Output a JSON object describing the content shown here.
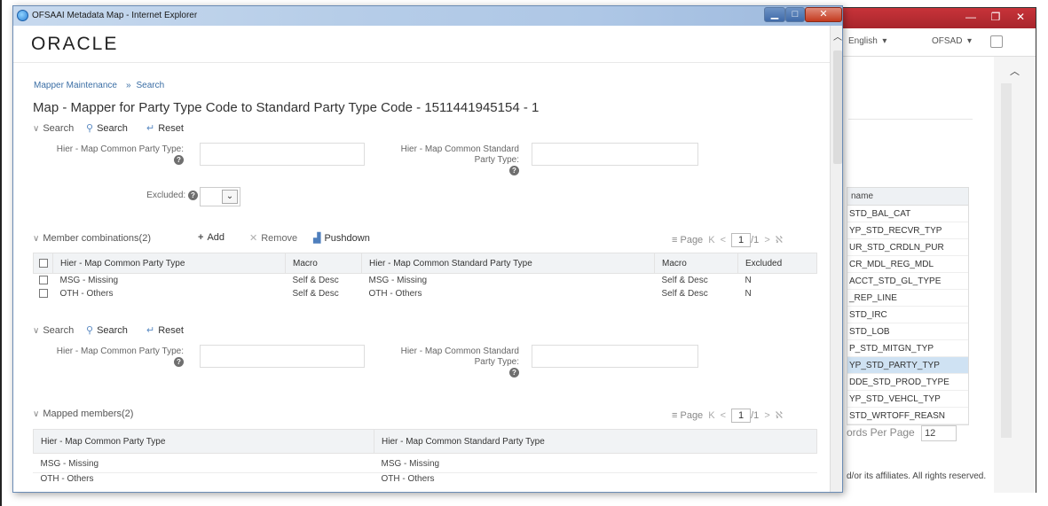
{
  "window": {
    "title": "OFSAAI Metadata Map - Internet Explorer",
    "logo": "ORACLE"
  },
  "breadcrumb": [
    "Mapper Maintenance",
    "Search"
  ],
  "page_title": "Map - Mapper for Party Type Code to Standard Party Type Code - 1511441945154 - 1",
  "search1": {
    "header": "Search",
    "search_label": "Search",
    "reset_label": "Reset",
    "field1_label": "Hier - Map Common Party Type:",
    "field2_label_line1": "Hier - Map Common Standard",
    "field2_label_line2": "Party Type:",
    "excluded_label": "Excluded:"
  },
  "combinations": {
    "header": "Member combinations(2)",
    "add_label": "Add",
    "remove_label": "Remove",
    "pushdown_label": "Pushdown",
    "pager": {
      "label": "Page",
      "current": "1",
      "total": "/1"
    },
    "columns": [
      "Hier - Map Common Party Type",
      "Macro",
      "Hier - Map Common Standard Party Type",
      "Macro",
      "Excluded"
    ],
    "rows": [
      [
        "MSG - Missing",
        "Self & Desc",
        "MSG - Missing",
        "Self & Desc",
        "N"
      ],
      [
        "OTH - Others",
        "Self & Desc",
        "OTH - Others",
        "Self & Desc",
        "N"
      ]
    ]
  },
  "search2": {
    "header": "Search",
    "search_label": "Search",
    "reset_label": "Reset",
    "field1_label": "Hier - Map Common Party Type:",
    "field2_label_line1": "Hier - Map Common Standard",
    "field2_label_line2": "Party Type:"
  },
  "mapped": {
    "header": "Mapped members(2)",
    "pager": {
      "label": "Page",
      "current": "1",
      "total": "/1"
    },
    "columns": [
      "Hier - Map Common Party Type",
      "Hier - Map Common Standard Party Type"
    ],
    "rows": [
      [
        "MSG - Missing",
        "MSG - Missing"
      ],
      [
        "OTH - Others",
        "OTH - Others"
      ]
    ]
  },
  "background": {
    "language": "English",
    "user": "OFSAD",
    "table_header": "name",
    "rows": [
      "STD_BAL_CAT",
      "YP_STD_RECVR_TYP",
      "UR_STD_CRDLN_PUR",
      "CR_MDL_REG_MDL",
      "ACCT_STD_GL_TYPE",
      "_REP_LINE",
      "STD_IRC",
      "STD_LOB",
      "P_STD_MITGN_TYP",
      "YP_STD_PARTY_TYP",
      "DDE_STD_PROD_TYPE",
      "YP_STD_VEHCL_TYP",
      "STD_WRTOFF_REASN"
    ],
    "selected_index": 9,
    "records_label": "ords Per Page",
    "records_value": "12",
    "copyright": "d/or its affiliates. All rights reserved."
  }
}
